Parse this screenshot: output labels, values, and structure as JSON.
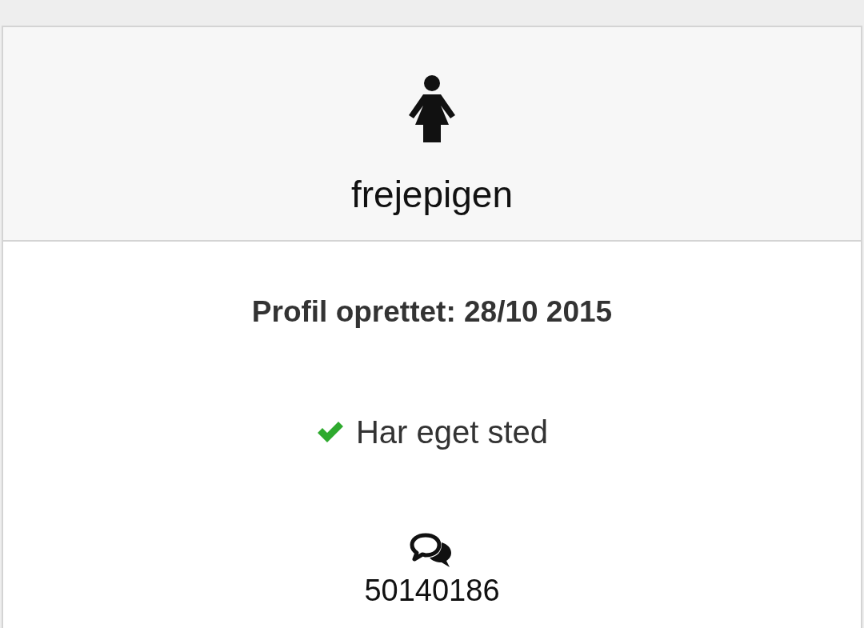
{
  "profile": {
    "username": "frejepigen"
  },
  "created": "Profil oprettet: 28/10 2015",
  "features": [
    {
      "label": "Har eget sted",
      "checked": true
    }
  ],
  "message_count": "50140186"
}
